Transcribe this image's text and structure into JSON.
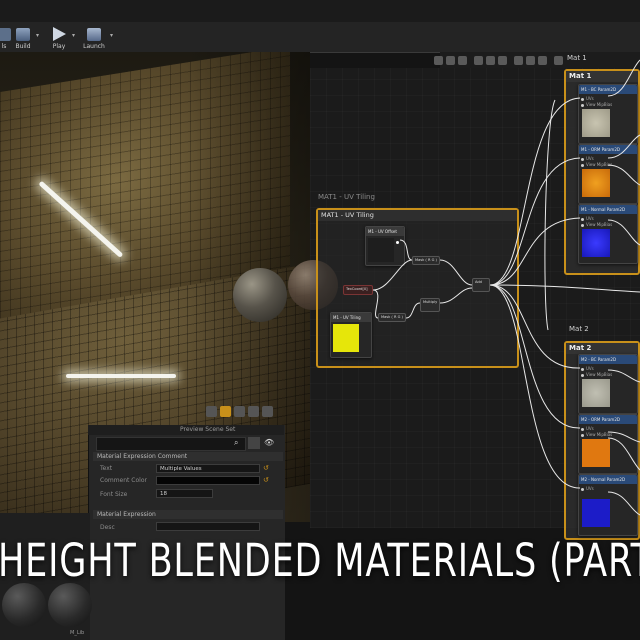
{
  "toolbar": {
    "buttons": [
      {
        "label": "ls"
      },
      {
        "label": "Build"
      },
      {
        "label": "Play"
      },
      {
        "label": "Launch"
      }
    ]
  },
  "viewport": {
    "preview_scene_label": "Preview Scene Set"
  },
  "graph": {
    "uv_comment_faded": "MAT1 - UV Tiling",
    "uv_comment": "MAT1 - UV Tiling",
    "mat1_tab": "Mat 1",
    "mat1_title": "Mat 1",
    "mat2_tab": "Mat 2",
    "mat2_title": "Mat 2",
    "uv_nodes": {
      "uv_offset": "M1 - UV Offset",
      "texcoord": "TexCoord[0]",
      "uv_tiling": "M1 - UV Tiling",
      "mask_a": "Mask ( R G )",
      "mask_b": "Mask ( R G )",
      "multiply": "Multiply",
      "add": "Add"
    },
    "tex_nodes": [
      {
        "title": "M1 - BC",
        "sub": "Param2D",
        "pins": [
          "UVs",
          "View MipBias"
        ]
      },
      {
        "title": "M1 - ORM",
        "sub": "Param2D",
        "pins": [
          "UVs",
          "View MipBias"
        ]
      },
      {
        "title": "M1 - Normal",
        "sub": "Param2D",
        "pins": [
          "UVs",
          "View MipBias"
        ]
      },
      {
        "title": "M2 - BC",
        "sub": "Param2D",
        "pins": [
          "UVs",
          "View MipBias"
        ]
      },
      {
        "title": "M2 - ORM",
        "sub": "Param2D",
        "pins": [
          "UVs",
          "View MipBias"
        ]
      },
      {
        "title": "M2 - Normal",
        "sub": "Param2D",
        "pins": [
          "UVs"
        ]
      }
    ]
  },
  "details": {
    "category1": "Material Expression Comment",
    "rows": [
      {
        "label": "Text",
        "value": "Multiple Values"
      },
      {
        "label": "Comment Color",
        "value": ""
      },
      {
        "label": "Font Size",
        "value": "18"
      }
    ],
    "category2": "Material Expression",
    "desc_label": "Desc"
  },
  "bottom_panel": {
    "item_label": "M_Lib"
  },
  "banner": {
    "title": "HEIGHT BLENDED MATERIALS (PART"
  },
  "colors": {
    "comment_border": "#c8901a",
    "uv_swatch": "#e6e60a",
    "bc_swatch": "#b8b4a2",
    "orm_swatch": "#e08a10",
    "normal_swatch": "#2020d0",
    "param_red": "#6a2a2a"
  }
}
